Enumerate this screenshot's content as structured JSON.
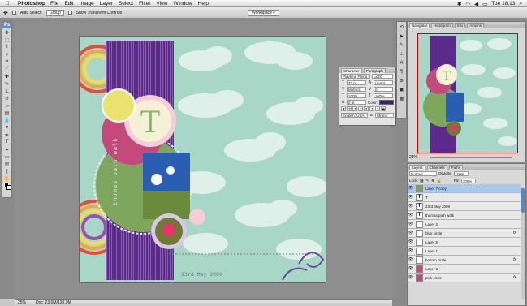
{
  "menubar": {
    "apple": "",
    "app": "Photoshop",
    "items": [
      "File",
      "Edit",
      "Image",
      "Layer",
      "Select",
      "Filter",
      "View",
      "Window",
      "Help"
    ],
    "clock": "Tue 18:13"
  },
  "options": {
    "auto_select": "Auto Select:",
    "auto_select_value": "Group",
    "transform": "Show Transform Controls",
    "workspace": "Workspace ▾"
  },
  "toolbox": {
    "header": "Ps"
  },
  "doc": {
    "zoom": "25%",
    "doc_size": "Doc: 23.0M/120.9M"
  },
  "canvas_text": {
    "monogram": "T",
    "side_text": "thomas path walk",
    "date": "23rd May 2009"
  },
  "character": {
    "tabs": [
      "Character",
      "Paragraph"
    ],
    "font": "Playtime Filling MT",
    "style": "Light",
    "size": "72 pt",
    "leading": "(Auto)",
    "kerning": "Metrics",
    "tracking": "0",
    "vscale": "100%",
    "hscale": "100%",
    "baseline": "0 pt",
    "color_label": "Color:",
    "language": "English: USA",
    "aa": "Strong",
    "color": "#3d1e6d"
  },
  "navigator": {
    "tabs": [
      "Navigator",
      "Histogram",
      "Info",
      "Actions"
    ],
    "zoom": "25%"
  },
  "layers": {
    "tabs": [
      "Layers",
      "Channels",
      "Paths"
    ],
    "blend": "Normal",
    "opacity_label": "Opacity:",
    "opacity": "100%",
    "lock_label": "Lock:",
    "fill_label": "Fill:",
    "fill": "100%",
    "rows": [
      {
        "name": "Layer 7 copy",
        "thumb": "",
        "selected": true,
        "fx": ""
      },
      {
        "name": "T",
        "thumb": "T",
        "selected": false,
        "fx": ""
      },
      {
        "name": "23rd May 2009",
        "thumb": "T",
        "selected": false,
        "fx": ""
      },
      {
        "name": "thomas path walk",
        "thumb": "T",
        "selected": false,
        "fx": ""
      },
      {
        "name": "Layer 2",
        "thumb": "",
        "selected": false,
        "fx": ""
      },
      {
        "name": "blue circle",
        "thumb": "",
        "selected": false,
        "fx": "fx"
      },
      {
        "name": "Layer 5",
        "thumb": "",
        "selected": false,
        "fx": ""
      },
      {
        "name": "Layer 1",
        "thumb": "",
        "selected": false,
        "fx": ""
      },
      {
        "name": "bottom circle",
        "thumb": "",
        "selected": false,
        "fx": "fx"
      },
      {
        "name": "Layer 6",
        "thumb": "",
        "selected": false,
        "fx": ""
      },
      {
        "name": "pink circle",
        "thumb": "",
        "selected": false,
        "fx": "fx"
      }
    ]
  }
}
